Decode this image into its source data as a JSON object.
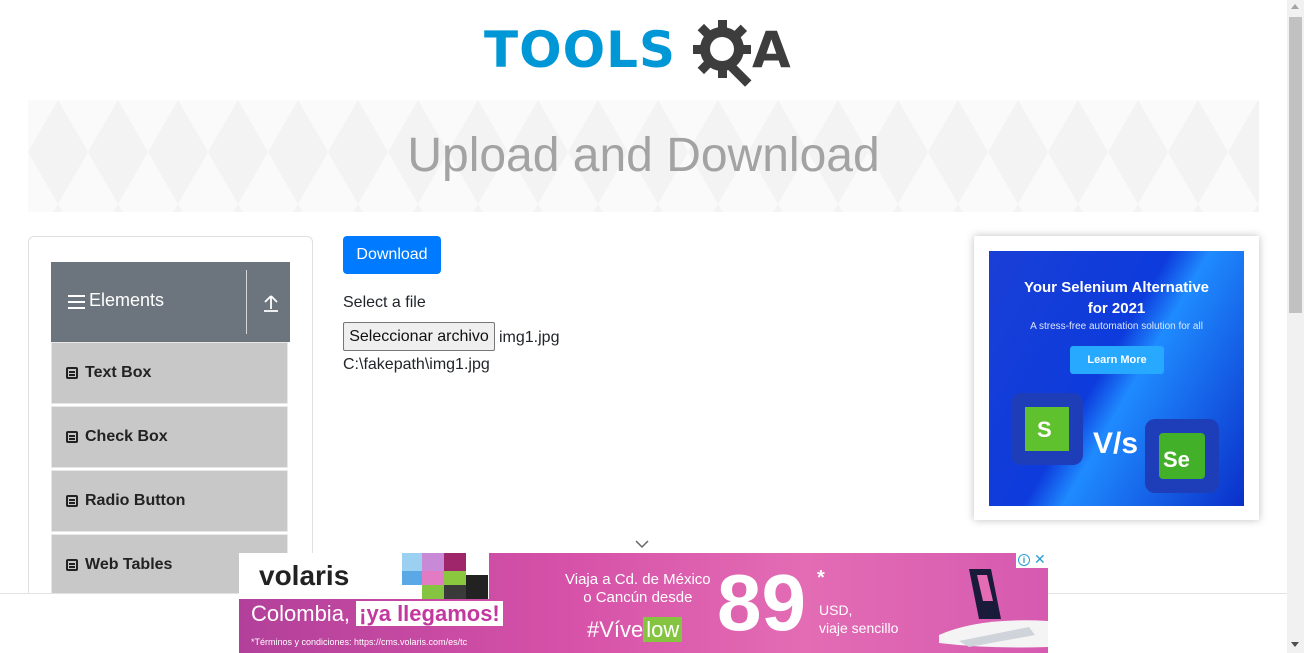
{
  "logo": {
    "part1": "TOOLS",
    "part2": "A",
    "icon": "gear-magnifier-icon"
  },
  "banner": {
    "title": "Upload and Download"
  },
  "sidebar": {
    "group_title": "Elements",
    "items": [
      {
        "label": "Text Box"
      },
      {
        "label": "Check Box"
      },
      {
        "label": "Radio Button"
      },
      {
        "label": "Web Tables"
      }
    ]
  },
  "main": {
    "download_label": "Download",
    "select_label": "Select a file",
    "file_button_label": "Seleccionar archivo",
    "file_name": "img1.jpg",
    "file_path": "C:\\fakepath\\img1.jpg"
  },
  "ad_right": {
    "title_line1": "Your Selenium Alternative",
    "title_line2": "for 2021",
    "subtitle": "A stress-free automation solution for all",
    "button_label": "Learn More",
    "logo_left_text": "S",
    "vs_text": "V/s",
    "logo_right_text": "Se"
  },
  "ad_bottom": {
    "brand": "volaris",
    "headline_prefix": "Colombia, ",
    "headline_highlight": "¡ya llegamos!",
    "terms": "*Términos y condiciones: https://cms.volaris.com/es/tc",
    "offer_line1": "Viaja a Cd. de México",
    "offer_line2": "o Cancún desde",
    "hashtag_prefix": "#Víve",
    "hashtag_highlight": "low",
    "price": "89",
    "price_mark": "*",
    "currency": "USD,",
    "trip_type": "viaje sencillo"
  },
  "colors": {
    "logo_blue": "#0097d7",
    "logo_dark": "#3d3d3d",
    "primary_button": "#007bff",
    "sidebar_header": "#6c757d",
    "sidebar_item": "#c8c8c8"
  }
}
